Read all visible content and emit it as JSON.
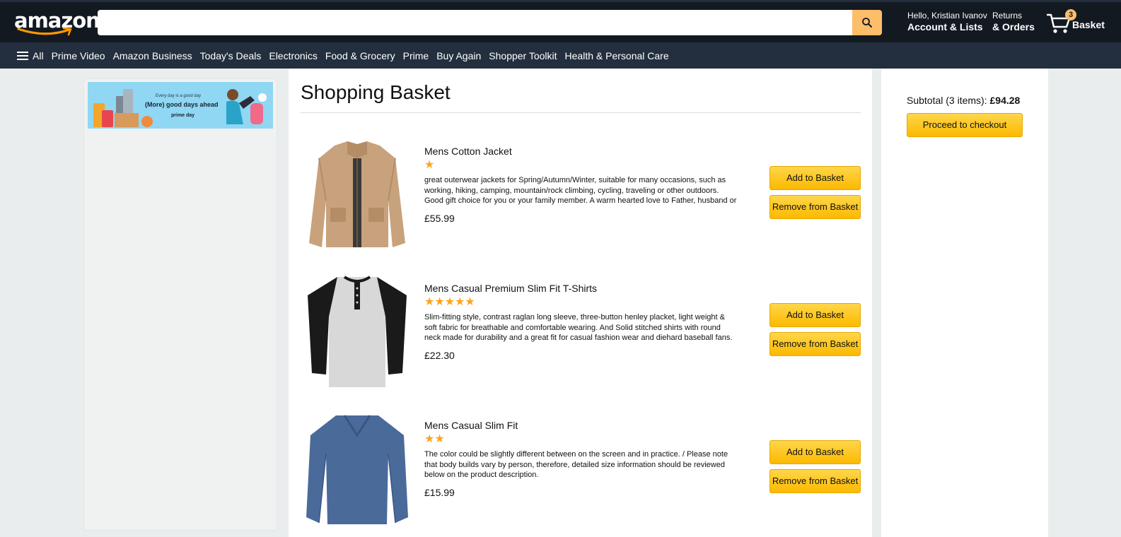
{
  "header": {
    "logo_text": "amazon",
    "search": {
      "value": "",
      "placeholder": ""
    },
    "account": {
      "greeting": "Hello, Kristian Ivanov",
      "label": "Account & Lists"
    },
    "orders": {
      "line1": "Returns",
      "line2": "& Orders"
    },
    "basket": {
      "count": "3",
      "label": "Basket"
    }
  },
  "nav": {
    "all_label": "All",
    "items": [
      "Prime Video",
      "Amazon Business",
      "Today's Deals",
      "Electronics",
      "Food & Grocery",
      "Prime",
      "Buy Again",
      "Shopper Toolkit",
      "Health & Personal Care"
    ]
  },
  "banner": {
    "line1": "Every day is a good day",
    "line2": "(More) good days ahead",
    "line3": "prime day"
  },
  "main": {
    "title": "Shopping Basket",
    "products": [
      {
        "title": "Mens Cotton Jacket",
        "rating": 1,
        "stars": "★",
        "description": "great outerwear jackets for Spring/Autumn/Winter, suitable for many occasions, such as working, hiking, camping, mountain/rock climbing, cycling, traveling or other outdoors. Good gift choice for you or your family member. A warm hearted love to Father, husband or son i...",
        "price": "£55.99",
        "add_label": "Add to Basket",
        "remove_label": "Remove from Basket"
      },
      {
        "title": "Mens Casual Premium Slim Fit T-Shirts",
        "rating": 5,
        "stars": "★★★★★",
        "description": "Slim-fitting style, contrast raglan long sleeve, three-button henley placket, light weight & soft fabric for breathable and comfortable wearing. And Solid stitched shirts with round neck made for durability and a great fit for casual fashion wear and diehard baseball fans. The...",
        "price": "£22.30",
        "add_label": "Add to Basket",
        "remove_label": "Remove from Basket"
      },
      {
        "title": "Mens Casual Slim Fit",
        "rating": 2,
        "stars": "★★",
        "description": "The color could be slightly different between on the screen and in practice. / Please note that body builds vary by person, therefore, detailed size information should be reviewed below on the product description.",
        "price": "£15.99",
        "add_label": "Add to Basket",
        "remove_label": "Remove from Basket"
      }
    ]
  },
  "summary": {
    "subtotal_label": "Subtotal (3 items):",
    "subtotal_value": "£94.28",
    "checkout_label": "Proceed to checkout"
  },
  "colors": {
    "header_bg": "#131921",
    "nav_bg": "#232f3e",
    "accent": "#febd69",
    "button": "#ffd64a",
    "star": "#ffa41c"
  }
}
